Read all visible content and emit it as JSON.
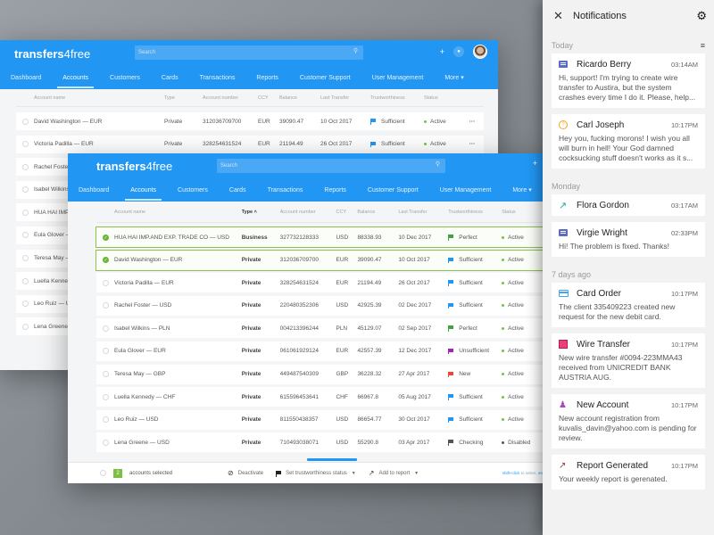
{
  "app": {
    "logo_bold": "transfers",
    "logo_thin": "4free",
    "search_placeholder": "Search",
    "plus_label": "+",
    "nav": [
      "Dashboard",
      "Accounts",
      "Customers",
      "Cards",
      "Transactions",
      "Reports",
      "Customer Support",
      "User Management",
      "More"
    ],
    "active_nav": "Accounts",
    "columns": [
      "Account name",
      "Type",
      "Account number",
      "CCY",
      "Balance",
      "Last Transfer",
      "Trustworthiness",
      "Status"
    ]
  },
  "back_window": {
    "rows": [
      {
        "name": "David Washington — EUR",
        "type": "Private",
        "number": "312036709700",
        "ccy": "EUR",
        "balance": "39090.47",
        "date": "10 Oct 2017",
        "trust": "Sufficient",
        "trust_color": "#2196f3",
        "status": "Active",
        "status_color": "#7cc043"
      },
      {
        "name": "Victoria Padilla — EUR",
        "type": "Private",
        "number": "328254631524",
        "ccy": "EUR",
        "balance": "21194.49",
        "date": "26 Oct 2017",
        "trust": "Sufficient",
        "trust_color": "#2196f3",
        "status": "Active",
        "status_color": "#7cc043"
      },
      {
        "name": "Rachel Foster — USD",
        "type": "",
        "number": "",
        "ccy": "",
        "balance": "",
        "date": "",
        "trust": "",
        "trust_color": "",
        "status": "",
        "status_color": ""
      },
      {
        "name": "Isabel Wilkins — PLN",
        "type": "",
        "number": "",
        "ccy": "",
        "balance": "",
        "date": "",
        "trust": "",
        "trust_color": "",
        "status": "",
        "status_color": ""
      },
      {
        "name": "HUA HAI IMP.AND EXP. TRADE CO — USD",
        "type": "",
        "number": "",
        "ccy": "",
        "balance": "",
        "date": "",
        "trust": "",
        "trust_color": "",
        "status": "",
        "status_color": ""
      },
      {
        "name": "Eula Glover — EUR",
        "type": "",
        "number": "",
        "ccy": "",
        "balance": "",
        "date": "",
        "trust": "",
        "trust_color": "",
        "status": "",
        "status_color": ""
      },
      {
        "name": "Teresa May — GBP",
        "type": "",
        "number": "",
        "ccy": "",
        "balance": "",
        "date": "",
        "trust": "",
        "trust_color": "",
        "status": "",
        "status_color": ""
      },
      {
        "name": "Luella Kennedy — CHF",
        "type": "",
        "number": "",
        "ccy": "",
        "balance": "",
        "date": "",
        "trust": "",
        "trust_color": "",
        "status": "",
        "status_color": ""
      },
      {
        "name": "Leo Ruiz — USD",
        "type": "",
        "number": "",
        "ccy": "",
        "balance": "",
        "date": "",
        "trust": "",
        "trust_color": "",
        "status": "",
        "status_color": ""
      },
      {
        "name": "Lena Greene — USD",
        "type": "",
        "number": "",
        "ccy": "",
        "balance": "",
        "date": "",
        "trust": "",
        "trust_color": "",
        "status": "",
        "status_color": ""
      }
    ]
  },
  "front_window": {
    "sort_indicator": "^",
    "rows": [
      {
        "name": "HUA HAI IMP.AND EXP. TRADE CO — USD",
        "type": "Business",
        "number": "327732128333",
        "ccy": "USD",
        "balance": "88338.93",
        "date": "10 Dec 2017",
        "trust": "Perfect",
        "trust_color": "#43a047",
        "status": "Active",
        "status_color": "#7cc043",
        "selected": true
      },
      {
        "name": "David Washington — EUR",
        "type": "Private",
        "number": "312036709700",
        "ccy": "EUR",
        "balance": "39090.47",
        "date": "10 Oct 2017",
        "trust": "Sufficient",
        "trust_color": "#2196f3",
        "status": "Active",
        "status_color": "#7cc043",
        "selected": true
      },
      {
        "name": "Victoria Padilla — EUR",
        "type": "Private",
        "number": "328254631524",
        "ccy": "EUR",
        "balance": "21194.49",
        "date": "26 Oct 2017",
        "trust": "Sufficient",
        "trust_color": "#2196f3",
        "status": "Active",
        "status_color": "#7cc043",
        "selected": false
      },
      {
        "name": "Rachel Foster — USD",
        "type": "Private",
        "number": "220480352306",
        "ccy": "USD",
        "balance": "42925.39",
        "date": "02 Dec 2017",
        "trust": "Sufficient",
        "trust_color": "#2196f3",
        "status": "Active",
        "status_color": "#7cc043",
        "selected": false
      },
      {
        "name": "Isabel Wilkins — PLN",
        "type": "Private",
        "number": "004213396244",
        "ccy": "PLN",
        "balance": "45129.07",
        "date": "02 Sep 2017",
        "trust": "Perfect",
        "trust_color": "#43a047",
        "status": "Active",
        "status_color": "#7cc043",
        "selected": false
      },
      {
        "name": "Eula Glover — EUR",
        "type": "Private",
        "number": "061061929124",
        "ccy": "EUR",
        "balance": "42557.39",
        "date": "12 Dec 2017",
        "trust": "Unsufficient",
        "trust_color": "#9c27b0",
        "status": "Active",
        "status_color": "#7cc043",
        "selected": false
      },
      {
        "name": "Teresa May — GBP",
        "type": "Private",
        "number": "449487540309",
        "ccy": "GBP",
        "balance": "36228.32",
        "date": "27 Apr 2017",
        "trust": "New",
        "trust_color": "#f44336",
        "status": "Active",
        "status_color": "#7cc043",
        "selected": false
      },
      {
        "name": "Luella Kennedy — CHF",
        "type": "Private",
        "number": "615596453641",
        "ccy": "CHF",
        "balance": "66967.8",
        "date": "05 Aug 2017",
        "trust": "Sufficient",
        "trust_color": "#2196f3",
        "status": "Active",
        "status_color": "#7cc043",
        "selected": false
      },
      {
        "name": "Leo Ruiz — USD",
        "type": "Private",
        "number": "811550438357",
        "ccy": "USD",
        "balance": "86654.77",
        "date": "30 Oct 2017",
        "trust": "Sufficient",
        "trust_color": "#2196f3",
        "status": "Active",
        "status_color": "#7cc043",
        "selected": false
      },
      {
        "name": "Lena Greene — USD",
        "type": "Private",
        "number": "710493038071",
        "ccy": "USD",
        "balance": "55290.8",
        "date": "03 Apr 2017",
        "trust": "Checking",
        "trust_color": "#555555",
        "status": "Disabled",
        "status_color": "#555555",
        "selected": false
      }
    ],
    "bottom_bar": {
      "selected_count": "2",
      "selected_label": "accounts selected",
      "deactivate": "Deactivate",
      "set_trust": "Set trustworthiness status",
      "add_report": "Add to report",
      "hint_key": "shift+click",
      "hint_text": "to select,",
      "hint_esc": "esc"
    }
  },
  "notifications": {
    "title": "Notifications",
    "sections": [
      {
        "label": "Today",
        "items": [
          {
            "icon": "chat-icon",
            "title": "Ricardo Berry",
            "time": "03:14AM",
            "body": "Hi, support! I'm trying to create wire transfer to Austira, but the system crashes every time I do it. Please, help..."
          },
          {
            "icon": "help-icon",
            "title": "Carl Joseph",
            "time": "10:17PM",
            "body": "Hey you, fucking morons! I wish you all will burn in hell! Your God damned cocksucking stuff doesn't works as it s..."
          }
        ]
      },
      {
        "label": "Monday",
        "items": [
          {
            "icon": "arrow-icon",
            "title": "Flora Gordon",
            "time": "03:17AM",
            "body": ""
          },
          {
            "icon": "chat-icon",
            "title": "Virgie Wright",
            "time": "02:33PM",
            "body": "Hi! The problem is fixed. Thanks!"
          }
        ]
      },
      {
        "label": "7 days ago",
        "items": [
          {
            "icon": "card-icon",
            "title": "Card Order",
            "time": "10:17PM",
            "body": "The client 335409223 created new request for the new debit card."
          },
          {
            "icon": "wire-icon",
            "title": "Wire Transfer",
            "time": "10:17PM",
            "body": "New wire transfer #0094-223MMA43 received from UNICREDIT BANK AUSTRIA AUG."
          },
          {
            "icon": "user-icon",
            "title": "New Account",
            "time": "10:17PM",
            "body": "New account registration from kuvalis_davin@yahoo.com is pending for review."
          },
          {
            "icon": "report-icon",
            "title": "Report Generated",
            "time": "10:17PM",
            "body": "Your weekly report is gerenated."
          }
        ]
      }
    ]
  }
}
